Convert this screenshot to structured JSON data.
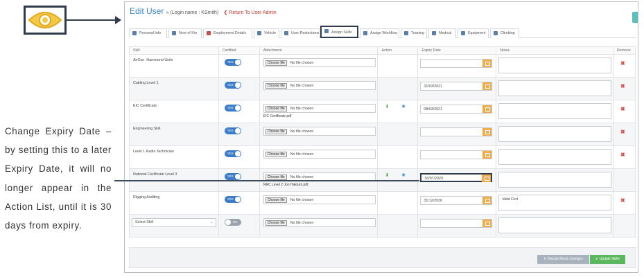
{
  "annotation": {
    "text": "Change Expiry Date – by setting this to a later Expiry Date, it will no longer appear in the Action List, until it is 30 days from expiry.",
    "eye_icon": "eye-icon"
  },
  "header": {
    "title": "Edit User",
    "login": "» (Login name : KSmith)",
    "return_link": "❮ Return To User Admin"
  },
  "tabs": [
    {
      "label": "Personal Info",
      "icon": "user-icon"
    },
    {
      "label": "Next of Kin",
      "icon": "users-icon"
    },
    {
      "label": "Employment Details",
      "icon": "briefcase-icon"
    },
    {
      "label": "Vehicle",
      "icon": "car-icon"
    },
    {
      "label": "User Restrictions",
      "icon": "gear-icon"
    },
    {
      "label": "Assign Skills",
      "icon": "wrench-icon"
    },
    {
      "label": "Assign Workflow",
      "icon": "flow-icon"
    },
    {
      "label": "Training",
      "icon": "book-icon"
    },
    {
      "label": "Medical",
      "icon": "medical-icon"
    },
    {
      "label": "Equipment",
      "icon": "tool-icon"
    },
    {
      "label": "Climbing",
      "icon": "climb-icon"
    }
  ],
  "table": {
    "headers": [
      "Skill",
      "Certified",
      "Attachment",
      "Action",
      "Expiry Date",
      "Notes",
      "Remove"
    ],
    "choose_file_label": "Choose file",
    "no_file_label": "No file chosen",
    "rows": [
      {
        "skill": "AirCon -Hammond Units",
        "certified": "YES",
        "file": "",
        "expiry": "",
        "notes": "",
        "has_actions": false
      },
      {
        "skill": "Cabling Level 1",
        "certified": "YES",
        "file": "",
        "expiry": "31/03/2021",
        "notes": "",
        "has_actions": false
      },
      {
        "skill": "EIC Certificate",
        "certified": "YES",
        "file": "EIC Certificate.pdf",
        "expiry": "08/03/2021",
        "notes": "",
        "has_actions": true
      },
      {
        "skill": "Engineering Skill",
        "certified": "YES",
        "file": "",
        "expiry": "",
        "notes": "",
        "has_actions": false
      },
      {
        "skill": "Level 1 Radio Technician",
        "certified": "YES",
        "file": "",
        "expiry": "",
        "notes": "",
        "has_actions": false
      },
      {
        "skill": "National Certificate Level 3",
        "certified": "YES",
        "file": "NRC Level 2 Jon Haktum.pdf",
        "expiry": "30/07/2020",
        "notes": "",
        "has_actions": true
      },
      {
        "skill": "Rigging Auditing",
        "certified": "YES",
        "file": "",
        "expiry": "31/12/2020",
        "notes": "Valid Cert",
        "has_actions": false
      }
    ],
    "new_row": {
      "select_placeholder": "Select Skill",
      "certified": "NO"
    }
  },
  "footer": {
    "discard_label": "↻ Discard these changes",
    "update_label": "✔ Update Skills"
  }
}
